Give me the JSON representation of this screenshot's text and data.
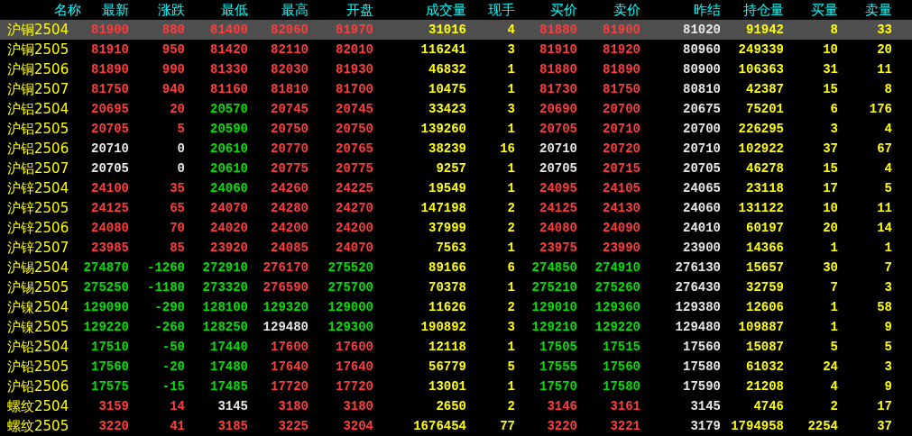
{
  "table": {
    "columns": [
      {
        "label": "名称",
        "kind": "name"
      },
      {
        "label": "最新",
        "kind": "price"
      },
      {
        "label": "涨跌",
        "kind": "price"
      },
      {
        "label": "最低",
        "kind": "price"
      },
      {
        "label": "最高",
        "kind": "price"
      },
      {
        "label": "开盘",
        "kind": "price"
      },
      {
        "label": "成交量",
        "kind": "volume"
      },
      {
        "label": "现手",
        "kind": "volume"
      },
      {
        "label": "买价",
        "kind": "price"
      },
      {
        "label": "卖价",
        "kind": "price"
      },
      {
        "label": "昨结",
        "kind": "reference"
      },
      {
        "label": "持仓量",
        "kind": "volume"
      },
      {
        "label": "买量",
        "kind": "volume"
      },
      {
        "label": "卖量",
        "kind": "volume"
      }
    ],
    "rows": [
      {
        "selected": true,
        "cells": [
          {
            "text": "沪铜2504"
          },
          {
            "text": "81900",
            "color": "#ff3c3c"
          },
          {
            "text": "880",
            "color": "#ff3c3c"
          },
          {
            "text": "81400",
            "color": "#ff3c3c"
          },
          {
            "text": "82060",
            "color": "#ff3c3c"
          },
          {
            "text": "81970",
            "color": "#ff3c3c"
          },
          {
            "text": "31016"
          },
          {
            "text": "4"
          },
          {
            "text": "81880",
            "color": "#ff3c3c"
          },
          {
            "text": "81900",
            "color": "#ff3c3c"
          },
          {
            "text": "81020"
          },
          {
            "text": "91942"
          },
          {
            "text": "8"
          },
          {
            "text": "33"
          }
        ]
      },
      {
        "selected": false,
        "cells": [
          {
            "text": "沪铜2505"
          },
          {
            "text": "81910",
            "color": "#ff3c3c"
          },
          {
            "text": "950",
            "color": "#ff3c3c"
          },
          {
            "text": "81420",
            "color": "#ff3c3c"
          },
          {
            "text": "82110",
            "color": "#ff3c3c"
          },
          {
            "text": "82010",
            "color": "#ff3c3c"
          },
          {
            "text": "116241"
          },
          {
            "text": "3"
          },
          {
            "text": "81910",
            "color": "#ff3c3c"
          },
          {
            "text": "81920",
            "color": "#ff3c3c"
          },
          {
            "text": "80960"
          },
          {
            "text": "249339"
          },
          {
            "text": "10"
          },
          {
            "text": "20"
          }
        ]
      },
      {
        "selected": false,
        "cells": [
          {
            "text": "沪铜2506"
          },
          {
            "text": "81890",
            "color": "#ff3c3c"
          },
          {
            "text": "990",
            "color": "#ff3c3c"
          },
          {
            "text": "81330",
            "color": "#ff3c3c"
          },
          {
            "text": "82030",
            "color": "#ff3c3c"
          },
          {
            "text": "81930",
            "color": "#ff3c3c"
          },
          {
            "text": "46832"
          },
          {
            "text": "1"
          },
          {
            "text": "81880",
            "color": "#ff3c3c"
          },
          {
            "text": "81890",
            "color": "#ff3c3c"
          },
          {
            "text": "80900"
          },
          {
            "text": "106363"
          },
          {
            "text": "31"
          },
          {
            "text": "11"
          }
        ]
      },
      {
        "selected": false,
        "cells": [
          {
            "text": "沪铜2507"
          },
          {
            "text": "81750",
            "color": "#ff3c3c"
          },
          {
            "text": "940",
            "color": "#ff3c3c"
          },
          {
            "text": "81160",
            "color": "#ff3c3c"
          },
          {
            "text": "81810",
            "color": "#ff3c3c"
          },
          {
            "text": "81700",
            "color": "#ff3c3c"
          },
          {
            "text": "10475"
          },
          {
            "text": "1"
          },
          {
            "text": "81730",
            "color": "#ff3c3c"
          },
          {
            "text": "81750",
            "color": "#ff3c3c"
          },
          {
            "text": "80810"
          },
          {
            "text": "42387"
          },
          {
            "text": "15"
          },
          {
            "text": "8"
          }
        ]
      },
      {
        "selected": false,
        "cells": [
          {
            "text": "沪铝2504"
          },
          {
            "text": "20695",
            "color": "#ff3c3c"
          },
          {
            "text": "20",
            "color": "#ff3c3c"
          },
          {
            "text": "20570",
            "color": "#00e000"
          },
          {
            "text": "20745",
            "color": "#ff3c3c"
          },
          {
            "text": "20745",
            "color": "#ff3c3c"
          },
          {
            "text": "33423"
          },
          {
            "text": "3"
          },
          {
            "text": "20690",
            "color": "#ff3c3c"
          },
          {
            "text": "20700",
            "color": "#ff3c3c"
          },
          {
            "text": "20675"
          },
          {
            "text": "75201"
          },
          {
            "text": "6"
          },
          {
            "text": "176"
          }
        ]
      },
      {
        "selected": false,
        "cells": [
          {
            "text": "沪铝2505"
          },
          {
            "text": "20705",
            "color": "#ff3c3c"
          },
          {
            "text": "5",
            "color": "#ff3c3c"
          },
          {
            "text": "20590",
            "color": "#00e000"
          },
          {
            "text": "20750",
            "color": "#ff3c3c"
          },
          {
            "text": "20750",
            "color": "#ff3c3c"
          },
          {
            "text": "139260"
          },
          {
            "text": "1"
          },
          {
            "text": "20705",
            "color": "#ff3c3c"
          },
          {
            "text": "20710",
            "color": "#ff3c3c"
          },
          {
            "text": "20700"
          },
          {
            "text": "226295"
          },
          {
            "text": "3"
          },
          {
            "text": "4"
          }
        ]
      },
      {
        "selected": false,
        "cells": [
          {
            "text": "沪铝2506"
          },
          {
            "text": "20710",
            "color": "#e6e6e6"
          },
          {
            "text": "0",
            "color": "#e6e6e6"
          },
          {
            "text": "20610",
            "color": "#00e000"
          },
          {
            "text": "20770",
            "color": "#ff3c3c"
          },
          {
            "text": "20765",
            "color": "#ff3c3c"
          },
          {
            "text": "38239"
          },
          {
            "text": "16"
          },
          {
            "text": "20710",
            "color": "#e6e6e6"
          },
          {
            "text": "20720",
            "color": "#ff3c3c"
          },
          {
            "text": "20710"
          },
          {
            "text": "102922"
          },
          {
            "text": "37"
          },
          {
            "text": "67"
          }
        ]
      },
      {
        "selected": false,
        "cells": [
          {
            "text": "沪铝2507"
          },
          {
            "text": "20705",
            "color": "#e6e6e6"
          },
          {
            "text": "0",
            "color": "#e6e6e6"
          },
          {
            "text": "20610",
            "color": "#00e000"
          },
          {
            "text": "20775",
            "color": "#ff3c3c"
          },
          {
            "text": "20775",
            "color": "#ff3c3c"
          },
          {
            "text": "9257"
          },
          {
            "text": "1"
          },
          {
            "text": "20705",
            "color": "#e6e6e6"
          },
          {
            "text": "20715",
            "color": "#ff3c3c"
          },
          {
            "text": "20705"
          },
          {
            "text": "46278"
          },
          {
            "text": "15"
          },
          {
            "text": "4"
          }
        ]
      },
      {
        "selected": false,
        "cells": [
          {
            "text": "沪锌2504"
          },
          {
            "text": "24100",
            "color": "#ff3c3c"
          },
          {
            "text": "35",
            "color": "#ff3c3c"
          },
          {
            "text": "24060",
            "color": "#00e000"
          },
          {
            "text": "24260",
            "color": "#ff3c3c"
          },
          {
            "text": "24225",
            "color": "#ff3c3c"
          },
          {
            "text": "19549"
          },
          {
            "text": "1"
          },
          {
            "text": "24095",
            "color": "#ff3c3c"
          },
          {
            "text": "24105",
            "color": "#ff3c3c"
          },
          {
            "text": "24065"
          },
          {
            "text": "23118"
          },
          {
            "text": "17"
          },
          {
            "text": "5"
          }
        ]
      },
      {
        "selected": false,
        "cells": [
          {
            "text": "沪锌2505"
          },
          {
            "text": "24125",
            "color": "#ff3c3c"
          },
          {
            "text": "65",
            "color": "#ff3c3c"
          },
          {
            "text": "24070",
            "color": "#ff3c3c"
          },
          {
            "text": "24280",
            "color": "#ff3c3c"
          },
          {
            "text": "24270",
            "color": "#ff3c3c"
          },
          {
            "text": "147198"
          },
          {
            "text": "2"
          },
          {
            "text": "24125",
            "color": "#ff3c3c"
          },
          {
            "text": "24130",
            "color": "#ff3c3c"
          },
          {
            "text": "24060"
          },
          {
            "text": "131122"
          },
          {
            "text": "10"
          },
          {
            "text": "11"
          }
        ]
      },
      {
        "selected": false,
        "cells": [
          {
            "text": "沪锌2506"
          },
          {
            "text": "24080",
            "color": "#ff3c3c"
          },
          {
            "text": "70",
            "color": "#ff3c3c"
          },
          {
            "text": "24020",
            "color": "#ff3c3c"
          },
          {
            "text": "24200",
            "color": "#ff3c3c"
          },
          {
            "text": "24200",
            "color": "#ff3c3c"
          },
          {
            "text": "37999"
          },
          {
            "text": "2"
          },
          {
            "text": "24080",
            "color": "#ff3c3c"
          },
          {
            "text": "24090",
            "color": "#ff3c3c"
          },
          {
            "text": "24010"
          },
          {
            "text": "60197"
          },
          {
            "text": "20"
          },
          {
            "text": "14"
          }
        ]
      },
      {
        "selected": false,
        "cells": [
          {
            "text": "沪锌2507"
          },
          {
            "text": "23985",
            "color": "#ff3c3c"
          },
          {
            "text": "85",
            "color": "#ff3c3c"
          },
          {
            "text": "23920",
            "color": "#ff3c3c"
          },
          {
            "text": "24085",
            "color": "#ff3c3c"
          },
          {
            "text": "24070",
            "color": "#ff3c3c"
          },
          {
            "text": "7563"
          },
          {
            "text": "1"
          },
          {
            "text": "23975",
            "color": "#ff3c3c"
          },
          {
            "text": "23990",
            "color": "#ff3c3c"
          },
          {
            "text": "23900"
          },
          {
            "text": "14366"
          },
          {
            "text": "1"
          },
          {
            "text": "1"
          }
        ]
      },
      {
        "selected": false,
        "cells": [
          {
            "text": "沪锡2504"
          },
          {
            "text": "274870",
            "color": "#00e000"
          },
          {
            "text": "-1260",
            "color": "#00e000"
          },
          {
            "text": "272910",
            "color": "#00e000"
          },
          {
            "text": "276170",
            "color": "#ff3c3c"
          },
          {
            "text": "275520",
            "color": "#00e000"
          },
          {
            "text": "89166"
          },
          {
            "text": "6"
          },
          {
            "text": "274850",
            "color": "#00e000"
          },
          {
            "text": "274910",
            "color": "#00e000"
          },
          {
            "text": "276130"
          },
          {
            "text": "15657"
          },
          {
            "text": "30"
          },
          {
            "text": "7"
          }
        ]
      },
      {
        "selected": false,
        "cells": [
          {
            "text": "沪锡2505"
          },
          {
            "text": "275250",
            "color": "#00e000"
          },
          {
            "text": "-1180",
            "color": "#00e000"
          },
          {
            "text": "273320",
            "color": "#00e000"
          },
          {
            "text": "276590",
            "color": "#ff3c3c"
          },
          {
            "text": "275700",
            "color": "#00e000"
          },
          {
            "text": "70378"
          },
          {
            "text": "1"
          },
          {
            "text": "275210",
            "color": "#00e000"
          },
          {
            "text": "275260",
            "color": "#00e000"
          },
          {
            "text": "276430"
          },
          {
            "text": "32759"
          },
          {
            "text": "7"
          },
          {
            "text": "3"
          }
        ]
      },
      {
        "selected": false,
        "cells": [
          {
            "text": "沪镍2504"
          },
          {
            "text": "129090",
            "color": "#00e000"
          },
          {
            "text": "-290",
            "color": "#00e000"
          },
          {
            "text": "128100",
            "color": "#00e000"
          },
          {
            "text": "129320",
            "color": "#00e000"
          },
          {
            "text": "129000",
            "color": "#00e000"
          },
          {
            "text": "11626"
          },
          {
            "text": "2"
          },
          {
            "text": "129010",
            "color": "#00e000"
          },
          {
            "text": "129360",
            "color": "#00e000"
          },
          {
            "text": "129380"
          },
          {
            "text": "12606"
          },
          {
            "text": "1"
          },
          {
            "text": "58"
          }
        ]
      },
      {
        "selected": false,
        "cells": [
          {
            "text": "沪镍2505"
          },
          {
            "text": "129220",
            "color": "#00e000"
          },
          {
            "text": "-260",
            "color": "#00e000"
          },
          {
            "text": "128250",
            "color": "#00e000"
          },
          {
            "text": "129480",
            "color": "#e6e6e6"
          },
          {
            "text": "129300",
            "color": "#00e000"
          },
          {
            "text": "190892"
          },
          {
            "text": "3"
          },
          {
            "text": "129210",
            "color": "#00e000"
          },
          {
            "text": "129220",
            "color": "#00e000"
          },
          {
            "text": "129480"
          },
          {
            "text": "109887"
          },
          {
            "text": "1"
          },
          {
            "text": "9"
          }
        ]
      },
      {
        "selected": false,
        "cells": [
          {
            "text": "沪铅2504"
          },
          {
            "text": "17510",
            "color": "#00e000"
          },
          {
            "text": "-50",
            "color": "#00e000"
          },
          {
            "text": "17440",
            "color": "#00e000"
          },
          {
            "text": "17600",
            "color": "#ff3c3c"
          },
          {
            "text": "17600",
            "color": "#ff3c3c"
          },
          {
            "text": "12118"
          },
          {
            "text": "1"
          },
          {
            "text": "17505",
            "color": "#00e000"
          },
          {
            "text": "17515",
            "color": "#00e000"
          },
          {
            "text": "17560"
          },
          {
            "text": "15087"
          },
          {
            "text": "5"
          },
          {
            "text": "5"
          }
        ]
      },
      {
        "selected": false,
        "cells": [
          {
            "text": "沪铅2505"
          },
          {
            "text": "17560",
            "color": "#00e000"
          },
          {
            "text": "-20",
            "color": "#00e000"
          },
          {
            "text": "17480",
            "color": "#00e000"
          },
          {
            "text": "17640",
            "color": "#ff3c3c"
          },
          {
            "text": "17640",
            "color": "#ff3c3c"
          },
          {
            "text": "56779"
          },
          {
            "text": "5"
          },
          {
            "text": "17555",
            "color": "#00e000"
          },
          {
            "text": "17560",
            "color": "#00e000"
          },
          {
            "text": "17580"
          },
          {
            "text": "61032"
          },
          {
            "text": "24"
          },
          {
            "text": "3"
          }
        ]
      },
      {
        "selected": false,
        "cells": [
          {
            "text": "沪铅2506"
          },
          {
            "text": "17575",
            "color": "#00e000"
          },
          {
            "text": "-15",
            "color": "#00e000"
          },
          {
            "text": "17485",
            "color": "#00e000"
          },
          {
            "text": "17720",
            "color": "#ff3c3c"
          },
          {
            "text": "17720",
            "color": "#ff3c3c"
          },
          {
            "text": "13001"
          },
          {
            "text": "1"
          },
          {
            "text": "17570",
            "color": "#00e000"
          },
          {
            "text": "17580",
            "color": "#00e000"
          },
          {
            "text": "17590"
          },
          {
            "text": "21208"
          },
          {
            "text": "4"
          },
          {
            "text": "9"
          }
        ]
      },
      {
        "selected": false,
        "cells": [
          {
            "text": "螺纹2504"
          },
          {
            "text": "3159",
            "color": "#ff3c3c"
          },
          {
            "text": "14",
            "color": "#ff3c3c"
          },
          {
            "text": "3145",
            "color": "#e6e6e6"
          },
          {
            "text": "3180",
            "color": "#ff3c3c"
          },
          {
            "text": "3180",
            "color": "#ff3c3c"
          },
          {
            "text": "2650"
          },
          {
            "text": "2"
          },
          {
            "text": "3146",
            "color": "#ff3c3c"
          },
          {
            "text": "3161",
            "color": "#ff3c3c"
          },
          {
            "text": "3145"
          },
          {
            "text": "4746"
          },
          {
            "text": "2"
          },
          {
            "text": "17"
          }
        ]
      },
      {
        "selected": false,
        "cells": [
          {
            "text": "螺纹2505"
          },
          {
            "text": "3220",
            "color": "#ff3c3c"
          },
          {
            "text": "41",
            "color": "#ff3c3c"
          },
          {
            "text": "3185",
            "color": "#ff3c3c"
          },
          {
            "text": "3225",
            "color": "#ff3c3c"
          },
          {
            "text": "3204",
            "color": "#ff3c3c"
          },
          {
            "text": "1676454"
          },
          {
            "text": "77"
          },
          {
            "text": "3220",
            "color": "#ff3c3c"
          },
          {
            "text": "3221",
            "color": "#ff3c3c"
          },
          {
            "text": "3179"
          },
          {
            "text": "1794958"
          },
          {
            "text": "2254"
          },
          {
            "text": "37"
          }
        ]
      }
    ]
  }
}
